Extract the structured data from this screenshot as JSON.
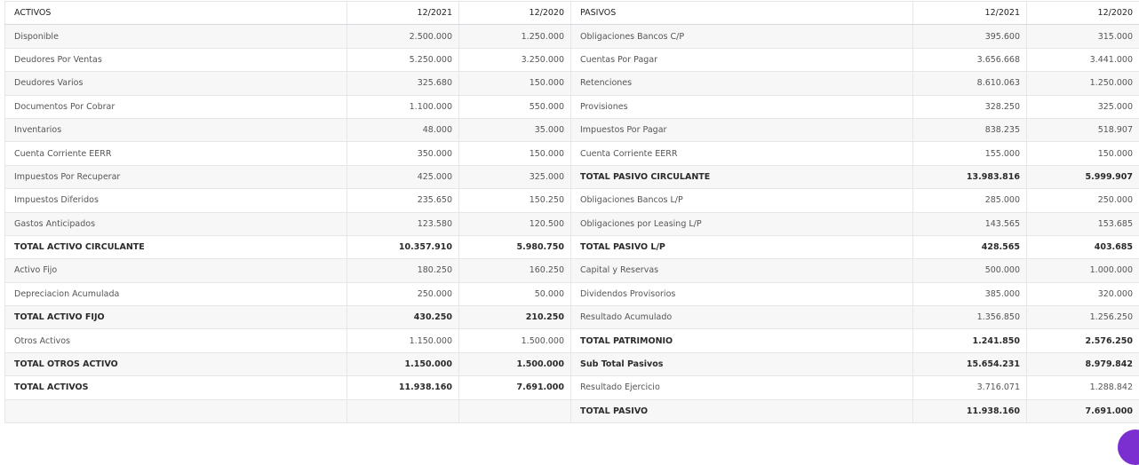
{
  "header": {
    "assets_label": "ACTIVOS",
    "assets_year_1": "12/2021",
    "assets_year_2": "12/2020",
    "liabilities_label": "PASIVOS",
    "liabilities_year_1": "12/2021",
    "liabilities_year_2": "12/2020"
  },
  "rows": [
    {
      "a_label": "Disponible",
      "a_2021": "2.500.000",
      "a_2020": "1.250.000",
      "a_bold": false,
      "p_label": "Obligaciones Bancos C/P",
      "p_2021": "395.600",
      "p_2020": "315.000",
      "p_bold": false
    },
    {
      "a_label": "Deudores Por Ventas",
      "a_2021": "5.250.000",
      "a_2020": "3.250.000",
      "a_bold": false,
      "p_label": "Cuentas Por Pagar",
      "p_2021": "3.656.668",
      "p_2020": "3.441.000",
      "p_bold": false
    },
    {
      "a_label": "Deudores Varios",
      "a_2021": "325.680",
      "a_2020": "150.000",
      "a_bold": false,
      "p_label": "Retenciones",
      "p_2021": "8.610.063",
      "p_2020": "1.250.000",
      "p_bold": false
    },
    {
      "a_label": "Documentos Por Cobrar",
      "a_2021": "1.100.000",
      "a_2020": "550.000",
      "a_bold": false,
      "p_label": "Provisiones",
      "p_2021": "328.250",
      "p_2020": "325.000",
      "p_bold": false
    },
    {
      "a_label": "Inventarios",
      "a_2021": "48.000",
      "a_2020": "35.000",
      "a_bold": false,
      "p_label": "Impuestos Por Pagar",
      "p_2021": "838.235",
      "p_2020": "518.907",
      "p_bold": false
    },
    {
      "a_label": "Cuenta Corriente EERR",
      "a_2021": "350.000",
      "a_2020": "150.000",
      "a_bold": false,
      "p_label": "Cuenta Corriente EERR",
      "p_2021": "155.000",
      "p_2020": "150.000",
      "p_bold": false
    },
    {
      "a_label": "Impuestos Por Recuperar",
      "a_2021": "425.000",
      "a_2020": "325.000",
      "a_bold": false,
      "p_label": "TOTAL PASIVO CIRCULANTE",
      "p_2021": "13.983.816",
      "p_2020": "5.999.907",
      "p_bold": true
    },
    {
      "a_label": "Impuestos Diferidos",
      "a_2021": "235.650",
      "a_2020": "150.250",
      "a_bold": false,
      "p_label": "Obligaciones Bancos L/P",
      "p_2021": "285.000",
      "p_2020": "250.000",
      "p_bold": false
    },
    {
      "a_label": "Gastos Anticipados",
      "a_2021": "123.580",
      "a_2020": "120.500",
      "a_bold": false,
      "p_label": "Obligaciones por Leasing L/P",
      "p_2021": "143.565",
      "p_2020": "153.685",
      "p_bold": false
    },
    {
      "a_label": "TOTAL ACTIVO CIRCULANTE",
      "a_2021": "10.357.910",
      "a_2020": "5.980.750",
      "a_bold": true,
      "p_label": "TOTAL PASIVO L/P",
      "p_2021": "428.565",
      "p_2020": "403.685",
      "p_bold": true
    },
    {
      "a_label": "Activo Fijo",
      "a_2021": "180.250",
      "a_2020": "160.250",
      "a_bold": false,
      "p_label": "Capital y Reservas",
      "p_2021": "500.000",
      "p_2020": "1.000.000",
      "p_bold": false
    },
    {
      "a_label": "Depreciacion Acumulada",
      "a_2021": "250.000",
      "a_2020": "50.000",
      "a_bold": false,
      "p_label": "Dividendos Provisorios",
      "p_2021": "385.000",
      "p_2020": "320.000",
      "p_bold": false
    },
    {
      "a_label": "TOTAL ACTIVO FIJO",
      "a_2021": "430.250",
      "a_2020": "210.250",
      "a_bold": true,
      "p_label": "Resultado Acumulado",
      "p_2021": "1.356.850",
      "p_2020": "1.256.250",
      "p_bold": false
    },
    {
      "a_label": "Otros Activos",
      "a_2021": "1.150.000",
      "a_2020": "1.500.000",
      "a_bold": false,
      "p_label": "TOTAL PATRIMONIO",
      "p_2021": "1.241.850",
      "p_2020": "2.576.250",
      "p_bold": true
    },
    {
      "a_label": "TOTAL OTROS ACTIVO",
      "a_2021": "1.150.000",
      "a_2020": "1.500.000",
      "a_bold": true,
      "p_label": "Sub Total Pasivos",
      "p_2021": "15.654.231",
      "p_2020": "8.979.842",
      "p_bold": true
    },
    {
      "a_label": "TOTAL ACTIVOS",
      "a_2021": "11.938.160",
      "a_2020": "7.691.000",
      "a_bold": true,
      "p_label": "Resultado Ejercicio",
      "p_2021": "3.716.071",
      "p_2020": "1.288.842",
      "p_bold": false
    },
    {
      "a_label": "",
      "a_2021": "",
      "a_2020": "",
      "a_bold": false,
      "p_label": "TOTAL PASIVO",
      "p_2021": "11.938.160",
      "p_2020": "7.691.000",
      "p_bold": true
    }
  ],
  "colors": {
    "row_stripe": "#f7f7f8",
    "border": "#e4e6ea",
    "corner_bubble": "#7b2fd0"
  },
  "icons": {
    "corner_bubble": "chat-bubble-icon"
  }
}
